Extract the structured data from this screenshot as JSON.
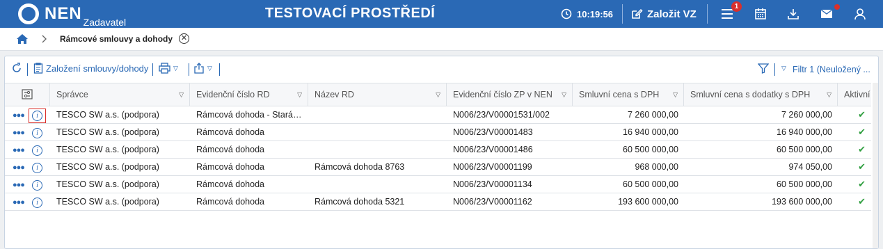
{
  "header": {
    "logo": "NEN",
    "role": "Zadavatel",
    "environment": "TESTOVACÍ PROSTŘEDÍ",
    "time": "10:19:56",
    "create_label": "Založit VZ",
    "notifications_count": "1",
    "icons": [
      "menu-icon",
      "calendar-icon",
      "download-icon",
      "mail-icon",
      "user-icon"
    ]
  },
  "breadcrumb": {
    "current": "Rámcové smlouvy a dohody"
  },
  "toolbar": {
    "create_label": "Založení smlouvy/dohody",
    "filter_label": "Filtr 1 (Neuložený ..."
  },
  "table": {
    "columns": [
      "Správce",
      "Evidenční číslo RD",
      "Název RD",
      "Evidenční číslo ZP v NEN",
      "Smluvní cena s DPH",
      "Smluvní cena s dodatky s DPH",
      "Aktivní"
    ],
    "rows": [
      {
        "spravce": "TESCO SW a.s. (podpora)",
        "ec_rd": "Rámcová dohoda - Stará…",
        "nazev": "",
        "ec_zp": "N006/23/V00001531/002",
        "cena": "7 260 000,00",
        "cena_dod": "7 260 000,00",
        "aktivni": "✔"
      },
      {
        "spravce": "TESCO SW a.s. (podpora)",
        "ec_rd": "Rámcová dohoda",
        "nazev": "",
        "ec_zp": "N006/23/V00001483",
        "cena": "16 940 000,00",
        "cena_dod": "16 940 000,00",
        "aktivni": "✔"
      },
      {
        "spravce": "TESCO SW a.s. (podpora)",
        "ec_rd": "Rámcová dohoda",
        "nazev": "",
        "ec_zp": "N006/23/V00001486",
        "cena": "60 500 000,00",
        "cena_dod": "60 500 000,00",
        "aktivni": "✔"
      },
      {
        "spravce": "TESCO SW a.s. (podpora)",
        "ec_rd": "Rámcová dohoda",
        "nazev": "Rámcová dohoda 8763",
        "ec_zp": "N006/23/V00001199",
        "cena": "968 000,00",
        "cena_dod": "974 050,00",
        "aktivni": "✔"
      },
      {
        "spravce": "TESCO SW a.s. (podpora)",
        "ec_rd": "Rámcová dohoda",
        "nazev": "",
        "ec_zp": "N006/23/V00001134",
        "cena": "60 500 000,00",
        "cena_dod": "60 500 000,00",
        "aktivni": "✔"
      },
      {
        "spravce": "TESCO SW a.s. (podpora)",
        "ec_rd": "Rámcová dohoda",
        "nazev": "Rámcová dohoda 5321",
        "ec_zp": "N006/23/V00001162",
        "cena": "193 600 000,00",
        "cena_dod": "193 600 000,00",
        "aktivni": "✔"
      }
    ]
  },
  "colors": {
    "brand": "#2a69b5",
    "badge": "#d9302c",
    "check": "#2e9e3e"
  }
}
